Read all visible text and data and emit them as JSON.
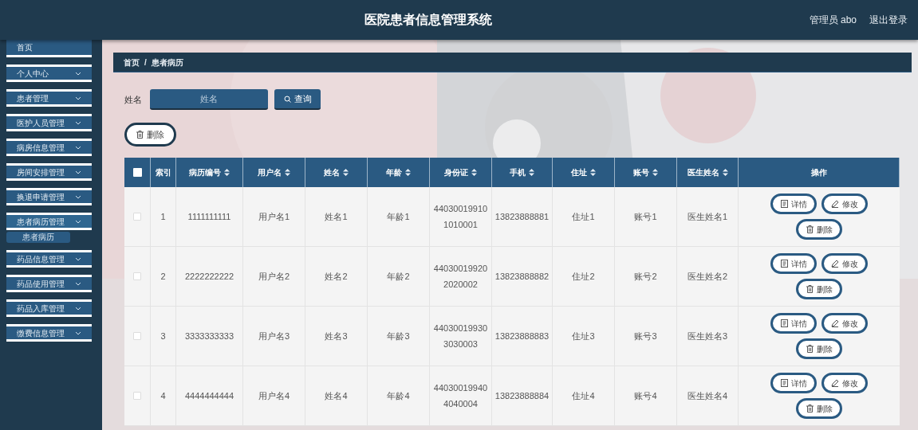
{
  "header": {
    "title": "医院患者信息管理系统",
    "user": "管理员 abo",
    "logout": "退出登录"
  },
  "sidebar": {
    "items": [
      {
        "label": "首页",
        "expandable": false,
        "expanded": false
      },
      {
        "label": "个人中心",
        "expandable": true,
        "expanded": false
      },
      {
        "label": "患者管理",
        "expandable": true,
        "expanded": false
      },
      {
        "label": "医护人员管理",
        "expandable": true,
        "expanded": false
      },
      {
        "label": "病房信息管理",
        "expandable": true,
        "expanded": false
      },
      {
        "label": "房间安排管理",
        "expandable": true,
        "expanded": false
      },
      {
        "label": "换退申请管理",
        "expandable": true,
        "expanded": false
      },
      {
        "label": "患者病历管理",
        "expandable": true,
        "expanded": true,
        "children": [
          {
            "label": "患者病历"
          }
        ]
      },
      {
        "label": "药品信息管理",
        "expandable": true,
        "expanded": false
      },
      {
        "label": "药品使用管理",
        "expandable": true,
        "expanded": false
      },
      {
        "label": "药品入库管理",
        "expandable": true,
        "expanded": false
      },
      {
        "label": "缴费信息管理",
        "expandable": true,
        "expanded": false
      }
    ]
  },
  "breadcrumb": [
    "首页",
    "/",
    "患者病历"
  ],
  "search": {
    "label": "姓名",
    "placeholder": "姓名",
    "button": "查询"
  },
  "delete_button": "删除",
  "table": {
    "columns": [
      {
        "kind": "checkbox",
        "checked": false
      },
      {
        "kind": "text",
        "label": "索引",
        "sortable": false
      },
      {
        "kind": "text",
        "label": "病历编号",
        "sortable": true
      },
      {
        "kind": "text",
        "label": "用户名",
        "sortable": true
      },
      {
        "kind": "text",
        "label": "姓名",
        "sortable": true
      },
      {
        "kind": "text",
        "label": "年龄",
        "sortable": true
      },
      {
        "kind": "text",
        "label": "身份证",
        "sortable": true
      },
      {
        "kind": "text",
        "label": "手机",
        "sortable": true
      },
      {
        "kind": "text",
        "label": "住址",
        "sortable": true
      },
      {
        "kind": "text",
        "label": "账号",
        "sortable": true
      },
      {
        "kind": "text",
        "label": "医生姓名",
        "sortable": true
      },
      {
        "kind": "actions",
        "label": "操作",
        "sortable": false
      }
    ],
    "rows": [
      {
        "checked": false,
        "cells": [
          "",
          "1",
          "1111111111",
          "用户名1",
          "姓名1",
          "年龄1",
          "440300199101010001",
          "13823888881",
          "住址1",
          "账号1",
          "医生姓名1"
        ],
        "actions": [
          {
            "kind": "detail",
            "label": "详情"
          },
          {
            "kind": "edit",
            "label": "修改"
          },
          {
            "kind": "delete",
            "label": "删除"
          }
        ]
      },
      {
        "checked": false,
        "cells": [
          "",
          "2",
          "2222222222",
          "用户名2",
          "姓名2",
          "年龄2",
          "440300199202020002",
          "13823888882",
          "住址2",
          "账号2",
          "医生姓名2"
        ],
        "actions": [
          {
            "kind": "detail",
            "label": "详情"
          },
          {
            "kind": "edit",
            "label": "修改"
          },
          {
            "kind": "delete",
            "label": "删除"
          }
        ]
      },
      {
        "checked": false,
        "cells": [
          "",
          "3",
          "3333333333",
          "用户名3",
          "姓名3",
          "年龄3",
          "440300199303030003",
          "13823888883",
          "住址3",
          "账号3",
          "医生姓名3"
        ],
        "actions": [
          {
            "kind": "detail",
            "label": "详情"
          },
          {
            "kind": "edit",
            "label": "修改"
          },
          {
            "kind": "delete",
            "label": "删除"
          }
        ]
      },
      {
        "checked": false,
        "cells": [
          "",
          "4",
          "4444444444",
          "用户名4",
          "姓名4",
          "年龄4",
          "440300199404040004",
          "13823888884",
          "住址4",
          "账号4",
          "医生姓名4"
        ],
        "actions": [
          {
            "kind": "detail",
            "label": "详情"
          },
          {
            "kind": "edit",
            "label": "修改"
          },
          {
            "kind": "delete",
            "label": "删除"
          }
        ]
      }
    ]
  }
}
